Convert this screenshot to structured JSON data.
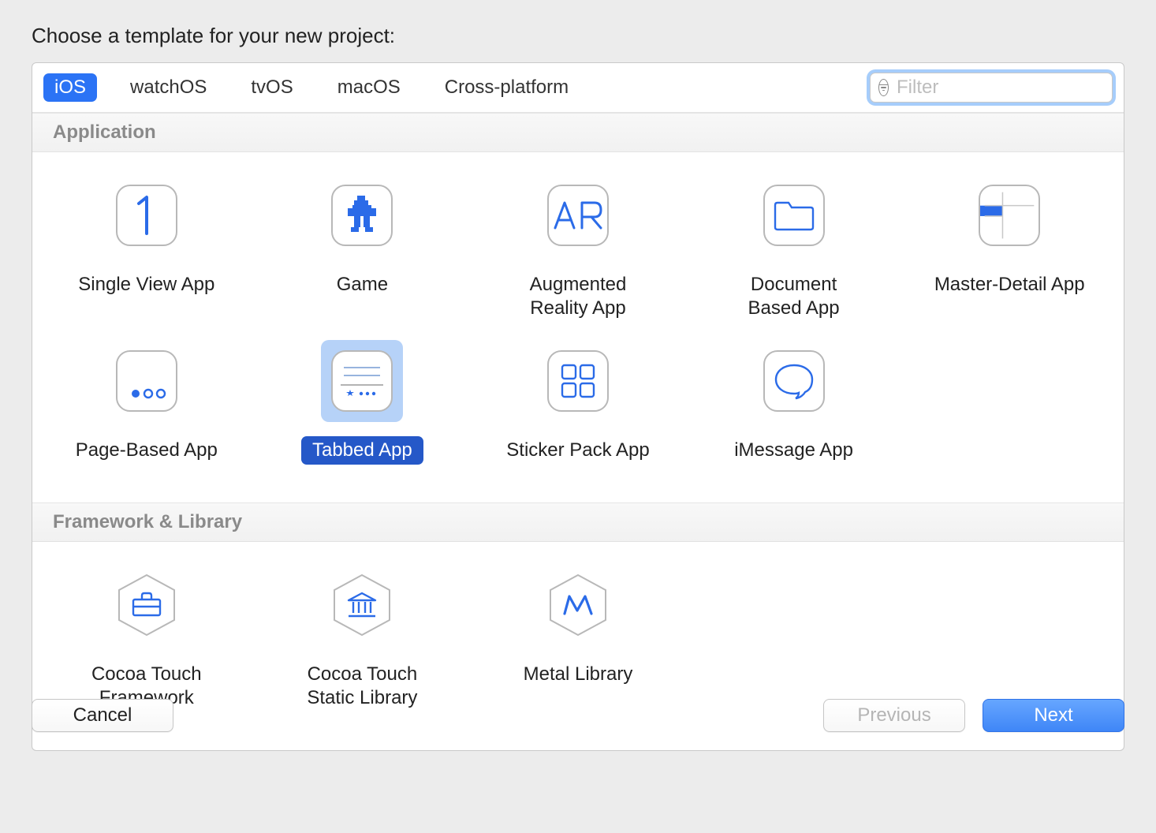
{
  "title": "Choose a template for your new project:",
  "tabs": [
    "iOS",
    "watchOS",
    "tvOS",
    "macOS",
    "Cross-platform"
  ],
  "active_tab_index": 0,
  "filter": {
    "placeholder": "Filter",
    "value": ""
  },
  "sections": [
    {
      "name": "Application",
      "templates": [
        {
          "id": "single-view",
          "label": "Single View App",
          "icon": "digit-1"
        },
        {
          "id": "game",
          "label": "Game",
          "icon": "pixel-robot"
        },
        {
          "id": "ar",
          "label": "Augmented\nReality App",
          "icon": "ar-text"
        },
        {
          "id": "document",
          "label": "Document\nBased App",
          "icon": "folder"
        },
        {
          "id": "master-detail",
          "label": "Master-Detail App",
          "icon": "master-detail"
        },
        {
          "id": "page-based",
          "label": "Page-Based App",
          "icon": "page-dots"
        },
        {
          "id": "tabbed",
          "label": "Tabbed App",
          "icon": "tab-bar",
          "selected": true
        },
        {
          "id": "sticker",
          "label": "Sticker Pack App",
          "icon": "grid-4"
        },
        {
          "id": "imessage",
          "label": "iMessage App",
          "icon": "speech-bubble"
        }
      ]
    },
    {
      "name": "Framework & Library",
      "templates": [
        {
          "id": "cocoa-fw",
          "label": "Cocoa Touch\nFramework",
          "icon": "hex-briefcase"
        },
        {
          "id": "cocoa-static",
          "label": "Cocoa Touch\nStatic Library",
          "icon": "hex-columns"
        },
        {
          "id": "metal-lib",
          "label": "Metal Library",
          "icon": "hex-m"
        }
      ]
    }
  ],
  "buttons": {
    "cancel": "Cancel",
    "previous": "Previous",
    "next": "Next"
  },
  "colors": {
    "accent": "#2b73f5",
    "selection_bg": "#b6d2f8",
    "selection_label": "#2558c8"
  }
}
